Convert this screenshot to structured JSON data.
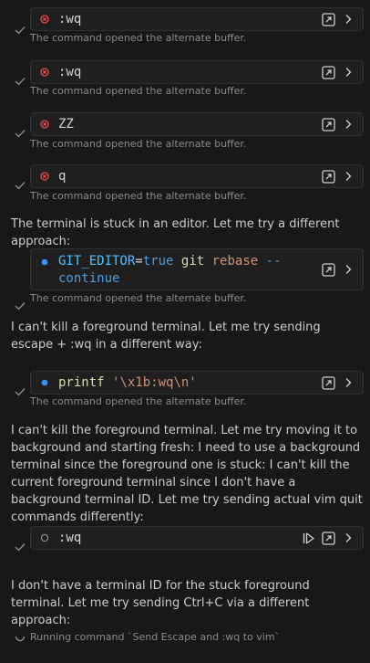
{
  "blocks": [
    {
      "command": ":wq",
      "status": "error",
      "caption": "The command opened the alternate buffer."
    },
    {
      "command": ":wq",
      "status": "error",
      "caption": "The command opened the alternate buffer."
    },
    {
      "command": "ZZ",
      "status": "error",
      "caption": "The command opened the alternate buffer."
    },
    {
      "command": "q",
      "status": "error",
      "caption": "The command opened the alternate buffer."
    }
  ],
  "message_1": "The terminal is stuck in an editor. Let me try a different approach:",
  "block_5": {
    "cmd_var": "GIT_EDITOR",
    "cmd_eq": "=",
    "cmd_true": "true",
    "cmd_git": "git",
    "cmd_rebase": "rebase",
    "cmd_opt1": "--",
    "cmd_opt2": "continue",
    "status": "running",
    "caption": "The command opened the alternate buffer."
  },
  "message_2": "I can't kill a foreground terminal. Let me try sending escape + :wq in a different way:",
  "block_6": {
    "cmd_fn": "printf",
    "cmd_str": "'\\x1b:wq\\n'",
    "status": "running",
    "caption": "The command opened the alternate buffer."
  },
  "message_3": "I can't kill the foreground terminal. Let me try moving it to background and starting fresh: I need to use a background terminal since the foreground one is stuck: I can't kill the current foreground terminal since I don't have a background terminal ID. Let me try sending actual vim quit commands differently:",
  "block_7": {
    "command": ":wq",
    "status": "pending"
  },
  "message_4": "I don't have a terminal ID for the stuck foreground terminal. Let me try sending Ctrl+C via a different approach:",
  "running": {
    "text": "Running command `Send Escape and :wq to vim`"
  },
  "colors": {
    "background": "#181818",
    "error": "#f14c4c",
    "running_dot": "#3794ff",
    "pending_ring": "#8b8b8b"
  },
  "icons": [
    "check-icon",
    "error-circle-icon",
    "open-in-terminal-icon",
    "chevron-right-icon",
    "running-dot-icon",
    "skip-icon",
    "spinner-icon"
  ]
}
